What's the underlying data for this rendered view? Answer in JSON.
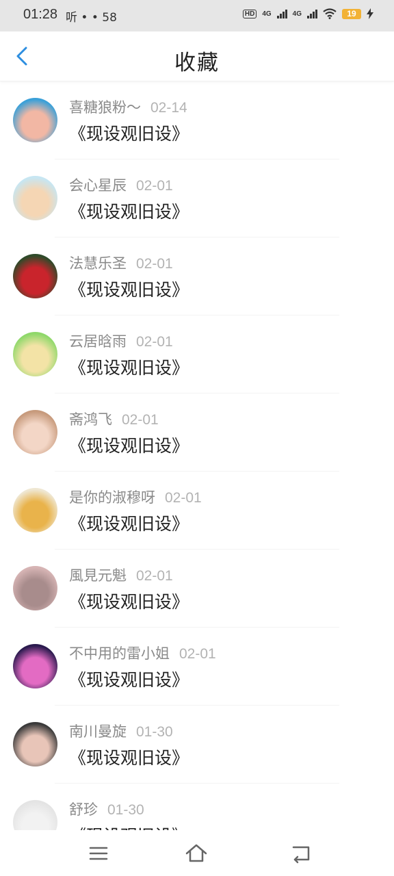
{
  "status_bar": {
    "time": "01:28",
    "extra": "听 • • 58",
    "hd": "HD",
    "net1": "4G",
    "net2": "4G",
    "battery": "19"
  },
  "header": {
    "title": "收藏",
    "back_icon": "chevron-left-icon"
  },
  "items": [
    {
      "name": "喜糖狼粉～",
      "date": "02-14",
      "title": "《现设观旧设》",
      "avatar_colors": [
        "#3aa0d8",
        "#f2b7a4"
      ]
    },
    {
      "name": "会心星辰",
      "date": "02-01",
      "title": "《现设观旧设》",
      "avatar_colors": [
        "#c7e6f2",
        "#f5d6b4"
      ]
    },
    {
      "name": "法慧乐圣",
      "date": "02-01",
      "title": "《现设观旧设》",
      "avatar_colors": [
        "#2e4a2a",
        "#c9242c"
      ]
    },
    {
      "name": "云居晗雨",
      "date": "02-01",
      "title": "《现设观旧设》",
      "avatar_colors": [
        "#8fd86a",
        "#f3e3a6"
      ]
    },
    {
      "name": "斋鸿飞",
      "date": "02-01",
      "title": "《现设观旧设》",
      "avatar_colors": [
        "#c79a7c",
        "#f3d6c6"
      ]
    },
    {
      "name": "是你的淑穆呀",
      "date": "02-01",
      "title": "《现设观旧设》",
      "avatar_colors": [
        "#efe7d2",
        "#e9b34b"
      ]
    },
    {
      "name": "風見元魁",
      "date": "02-01",
      "title": "《现设观旧设》",
      "avatar_colors": [
        "#d6b4b4",
        "#a88c8c"
      ]
    },
    {
      "name": "不中用的雷小姐",
      "date": "02-01",
      "title": "《现设观旧设》",
      "avatar_colors": [
        "#2a1a4e",
        "#e36bc3"
      ]
    },
    {
      "name": "南川曼旋",
      "date": "01-30",
      "title": "《现设观旧设》",
      "avatar_colors": [
        "#3a3a3a",
        "#e8c5b8"
      ]
    },
    {
      "name": "舒珍",
      "date": "01-30",
      "title": "《现设观旧设》",
      "avatar_colors": [
        "#e4e4e4",
        "#f2f2f2"
      ]
    }
  ],
  "nav_bar": {
    "menu_icon": "menu-icon",
    "home_icon": "home-icon",
    "back_icon": "back-icon"
  }
}
